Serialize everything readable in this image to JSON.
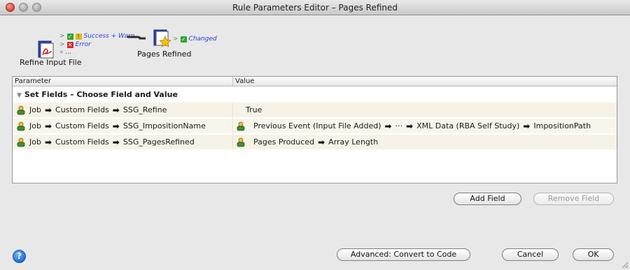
{
  "window": {
    "title": "Rule Parameters Editor – Pages Refined"
  },
  "flow": {
    "source_node": "Refine Input File",
    "source_outlets": [
      "Success + Warn",
      "Error",
      "..."
    ],
    "target_node": "Pages Refined",
    "target_outlet": "Changed",
    "source_icon": "pdf-document-icon",
    "target_icon": "star-document-icon"
  },
  "table": {
    "columns": [
      "Parameter",
      "Value"
    ],
    "section_title": "Set Fields – Choose Field and Value",
    "rows": [
      {
        "param": [
          "Job",
          "Custom Fields",
          "SSG_Refine"
        ],
        "value_has_icon": false,
        "value": [
          "True"
        ]
      },
      {
        "param": [
          "Job",
          "Custom Fields",
          "SSG_ImpositionName"
        ],
        "value_has_icon": true,
        "value": [
          "Previous Event (Input File Added)",
          "···",
          "XML Data (RBA Self Study)",
          "ImpositionPath"
        ]
      },
      {
        "param": [
          "Job",
          "Custom Fields",
          "SSG_PagesRefined"
        ],
        "value_has_icon": true,
        "value": [
          "Pages Produced",
          "Array Length"
        ]
      }
    ]
  },
  "buttons": {
    "add_field": "Add Field",
    "remove_field": "Remove Field",
    "advanced": "Advanced: Convert to Code",
    "cancel": "Cancel",
    "ok": "OK",
    "help": "?"
  },
  "colors": {
    "row_bg": "#f8f5ec",
    "outlet_text": "#2a3fd1",
    "success_badge": "#2fa52f",
    "error_badge": "#d22b2b"
  }
}
